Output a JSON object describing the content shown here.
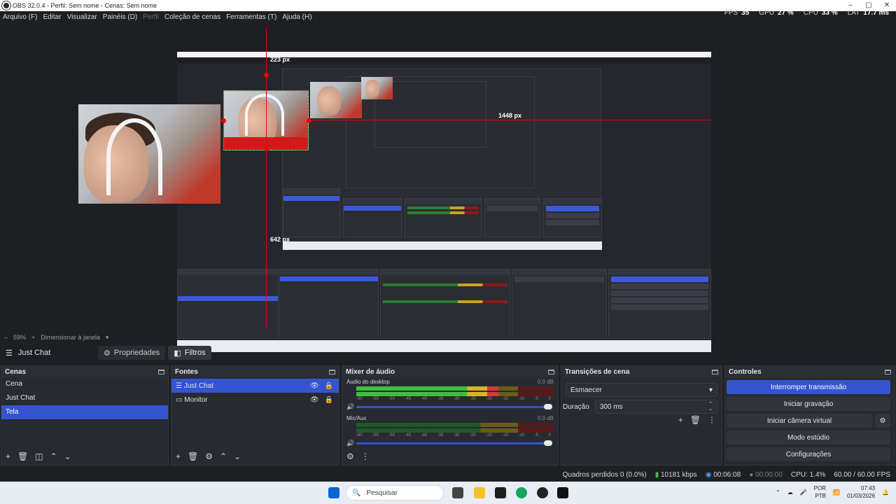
{
  "window": {
    "title": "OBS 32.0.4 - Perfil: Sem nome - Cenas: Sem nome",
    "controls": [
      "–",
      "▢",
      "✕"
    ]
  },
  "menu": {
    "items": [
      "Arquivo (F)",
      "Editar",
      "Visualizar",
      "Painéis (D)",
      "Perfil",
      "Coleção de cenas",
      "Ferramentas (T)",
      "Ajuda (H)"
    ]
  },
  "stats": {
    "fps_label": "FPS",
    "fps_value": "35",
    "gpu_label": "GPU",
    "gpu_value": "27 %",
    "cpu_label": "CPU",
    "cpu_value": "33 %",
    "lat_label": "LAT",
    "lat_value": "17.7 ms"
  },
  "preview": {
    "measure_top": "223 px",
    "measure_right": "1448 px",
    "measure_bottom": "642 px",
    "accent_red": "#e00000"
  },
  "zoom": {
    "minus": "–",
    "value": "59%",
    "plus": "+",
    "mode": "Dimensionar à janela"
  },
  "source_toolbar": {
    "name": "Just Chat",
    "properties_label": "Propriedades",
    "filters_label": "Filtros"
  },
  "docks": {
    "scenes": {
      "title": "Cenas",
      "items": [
        "Cena",
        "Just Chat",
        "Tela"
      ],
      "selected": "Tela"
    },
    "sources": {
      "title": "Fontes",
      "items": [
        "Just Chat",
        "Monitor"
      ]
    },
    "mixer": {
      "title": "Mixer de áudio",
      "channels": [
        {
          "name": "Áudio do desktop",
          "db": "0.0 dB",
          "level": 0.72
        },
        {
          "name": "Mic/Aux",
          "db": "0.0 dB",
          "level": 0.0
        }
      ],
      "ticks": [
        "-60",
        "-55",
        "-50",
        "-45",
        "-40",
        "-35",
        "-30",
        "-25",
        "-20",
        "-15",
        "-10",
        "-5",
        "0"
      ]
    },
    "transitions": {
      "title": "Transições de cena",
      "selected": "Esmaecer",
      "duration_label": "Duração",
      "duration_value": "300 ms"
    },
    "controls": {
      "title": "Controles",
      "buttons": [
        "Interromper transmissão",
        "Iniciar gravação",
        "Iniciar câmera virtual",
        "Modo estúdio",
        "Configurações"
      ]
    }
  },
  "status": {
    "dropped": "Quadros perdidos 0 (0.0%)",
    "bitrate": "10181 kbps",
    "stream_time": "00:06:08",
    "rec_time": "00:00:00",
    "cpu": "CPU: 1.4%",
    "fps": "60.00 / 60.00 FPS"
  },
  "taskbar": {
    "search_placeholder": "Pesquisar",
    "lang_top": "POR",
    "lang_bottom": "PTB",
    "time": "07:43",
    "date": "01/03/2026"
  },
  "colors": {
    "accent_blue": "#3454d1",
    "bg": "#1e1f22",
    "dock_bg": "#272a30"
  }
}
